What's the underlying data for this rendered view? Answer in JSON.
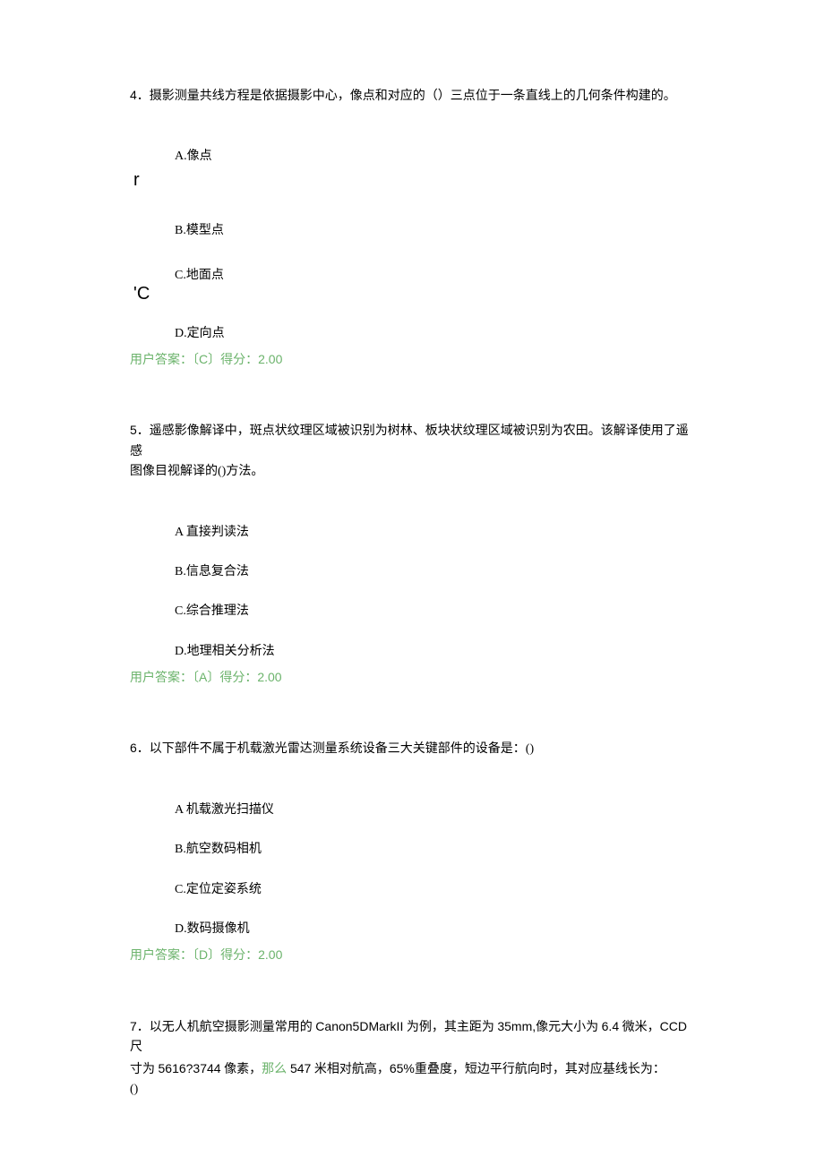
{
  "floating_marks": {
    "r": "r",
    "c": "'C"
  },
  "questions": [
    {
      "number": "4",
      "prompt": "．摄影测量共线方程是依据摄影中心，像点和对应的（）三点位于一条直线上的几何条件构建的。",
      "options": {
        "A": "A.像点",
        "B": "B.模型点",
        "C": "C.地面点",
        "D": "D.定向点"
      },
      "answer_prefix": "用户答案：〔",
      "answer_letter": "C",
      "answer_suffix": "〕得分：",
      "score": "2.00"
    },
    {
      "number": "5",
      "prompt1": "．遥感影像解译中，斑点状纹理区域被识别为树林、板块状纹理区域被识别为农田。该解译使用了遥感",
      "prompt2": "图像目视解译的()方法。",
      "options": {
        "A": "A 直接判读法",
        "B": "B.信息复合法",
        "C": "C.综合推理法",
        "D": "D.地理相关分析法"
      },
      "answer_prefix": "用户答案：〔",
      "answer_letter": "A",
      "answer_suffix": "〕得分：",
      "score": "2.00"
    },
    {
      "number": "6",
      "prompt": "．以下部件不属于机载激光雷达测量系统设备三大关键部件的设备是：()",
      "options": {
        "A": "A 机载激光扫描仪",
        "B": "B.航空数码相机",
        "C": "C.定位定姿系统",
        "D": "D.数码摄像机"
      },
      "answer_prefix": "用户答案：〔",
      "answer_letter": "D",
      "answer_suffix": "〕得分：",
      "score": "2.00"
    },
    {
      "number": "7",
      "prompt_parts": {
        "p1a": "．以无人机航空摄影测量常用的 ",
        "p1b": "Canon5DMarkII",
        "p1c": " 为例，其主距为 ",
        "p1d": "35mm,",
        "p1e": "像元大小为 ",
        "p1f": "6.4",
        "p1g": " 微米，",
        "p1h": "CCD",
        "p1i": " 尺",
        "p2a": "寸为 ",
        "p2b": "5616?3744",
        "p2c": " 像素，",
        "p2d": "那么",
        "p2e": " 547",
        "p2f": " 米相对航高，",
        "p2g": "65%",
        "p2h": "重叠度，短边平行航向时，其对应基线长为：",
        "p3": "()"
      }
    }
  ]
}
